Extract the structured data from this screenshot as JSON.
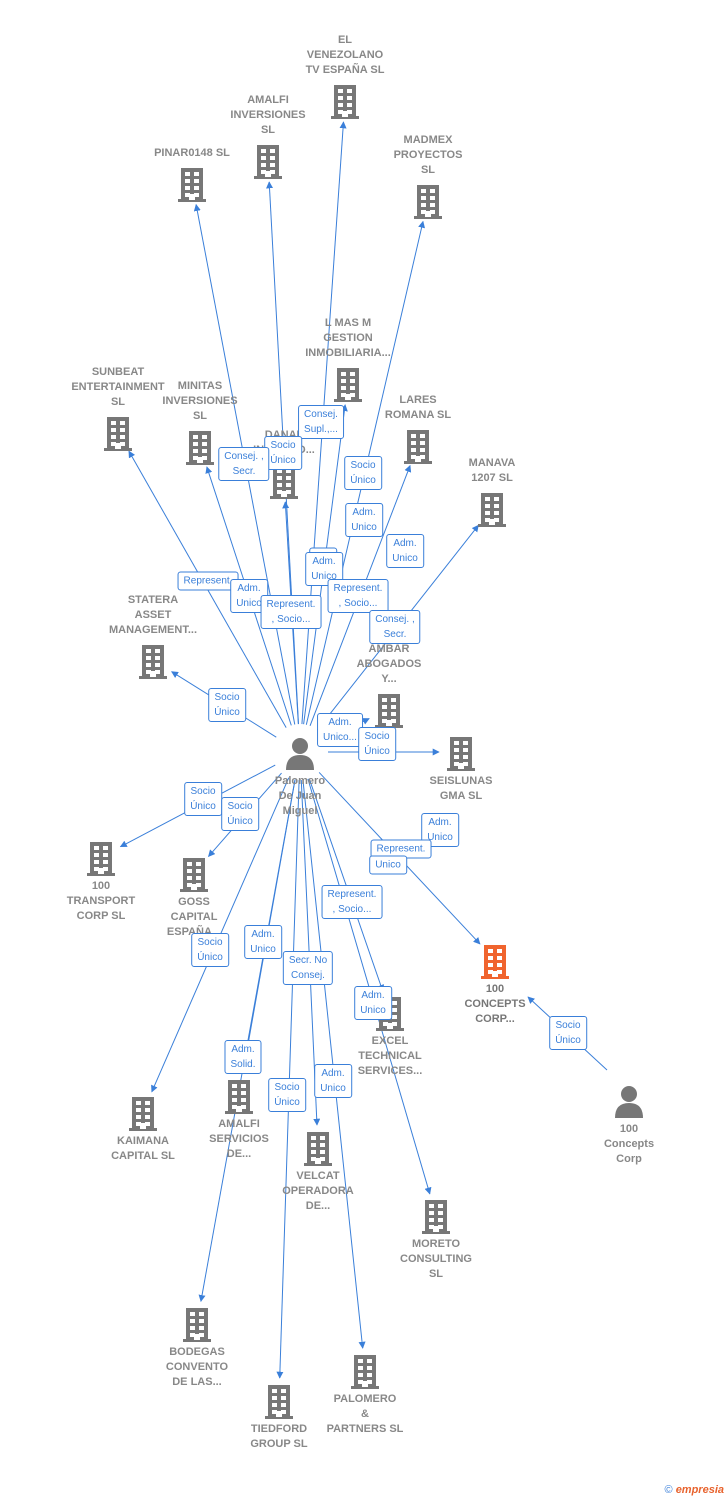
{
  "center": {
    "name": "Palomero\nDe Juan\nMiguel",
    "type": "person"
  },
  "companies": [
    {
      "id": "venezolano",
      "name": "EL\nVENEZOLANO\nTV ESPAÑA  SL"
    },
    {
      "id": "amalfi-inv",
      "name": "AMALFI\nINVERSIONES\nSL"
    },
    {
      "id": "pinar",
      "name": "PINAR0148  SL"
    },
    {
      "id": "madmex",
      "name": "MADMEX\nPROYECTOS\nSL"
    },
    {
      "id": "lmas",
      "name": "L MAS M\nGESTION\nINMOBILIARIA..."
    },
    {
      "id": "sunbeat",
      "name": "SUNBEAT\nENTERTAINMENT\nSL"
    },
    {
      "id": "minitas",
      "name": "MINITAS\nINVERSIONES\nSL"
    },
    {
      "id": "danal",
      "name": "DANAL\nINVERSIO..."
    },
    {
      "id": "lares",
      "name": "LARES\nROMANA  SL"
    },
    {
      "id": "manava",
      "name": "MANAVA\n1207  SL"
    },
    {
      "id": "statera",
      "name": "STATERA\nASSET\nMANAGEMENT..."
    },
    {
      "id": "ambar",
      "name": "AMBAR\nABOGADOS\nY..."
    },
    {
      "id": "seislunas",
      "name": "SEISLUNAS\nGMA  SL"
    },
    {
      "id": "transport",
      "name": "100\nTRANSPORT\nCORP  SL"
    },
    {
      "id": "goss",
      "name": "GOSS\nCAPITAL\nESPAÑA..."
    },
    {
      "id": "concepts",
      "name": "100\nCONCEPTS\nCORP...",
      "highlight": true
    },
    {
      "id": "excel",
      "name": "EXCEL\nTECHNICAL\nSERVICES..."
    },
    {
      "id": "kaimana",
      "name": "KAIMANA\nCAPITAL  SL"
    },
    {
      "id": "amalfi-serv",
      "name": "AMALFI\nSERVICIOS\nDE..."
    },
    {
      "id": "velcat",
      "name": "VELCAT\nOPERADORA\nDE..."
    },
    {
      "id": "moreto",
      "name": "MORETO\nCONSULTING\nSL"
    },
    {
      "id": "bodegas",
      "name": "BODEGAS\nCONVENTO\nDE LAS..."
    },
    {
      "id": "palomero-partners",
      "name": "PALOMERO\n&\nPARTNERS SL"
    },
    {
      "id": "tiedford",
      "name": "TIEDFORD\nGROUP  SL"
    }
  ],
  "other_person": {
    "name": "100\nConcepts\nCorp",
    "type": "person"
  },
  "edge_labels": [
    "Consej.\nSupl.,...",
    "Socio\nÚnico",
    "Consej. ,\nSecr.",
    "Socio\nÚnico",
    "Adm.\nUnico",
    "Adm.\nUnico",
    "R...",
    "Adm.\nUnico",
    "Represent.",
    "Adm.\nUnico",
    "Represent.\n, Socio...",
    "Represent.\n, Socio...",
    "Consej. ,\nSecr.",
    "Socio\nÚnico",
    "Adm.\nUnico...",
    "Socio\nÚnico",
    "Socio\nÚnico",
    "Socio\nÚnico",
    "Adm.\nUnico",
    "Represent.",
    "Unico",
    "Represent.\n, Socio...",
    "Socio\nÚnico",
    "Adm.\nUnico",
    "Secr.  No\nConsej.",
    "Adm.\nUnico",
    "Socio\nÚnico",
    "Adm.\nSolid.",
    "Socio\nÚnico",
    "Adm.\nUnico"
  ],
  "colors": {
    "edge": "#3a7fd9",
    "building": "#777777",
    "highlight": "#f0642e",
    "person": "#777777"
  },
  "footer": {
    "copyright": "©",
    "brand": "empresia"
  }
}
